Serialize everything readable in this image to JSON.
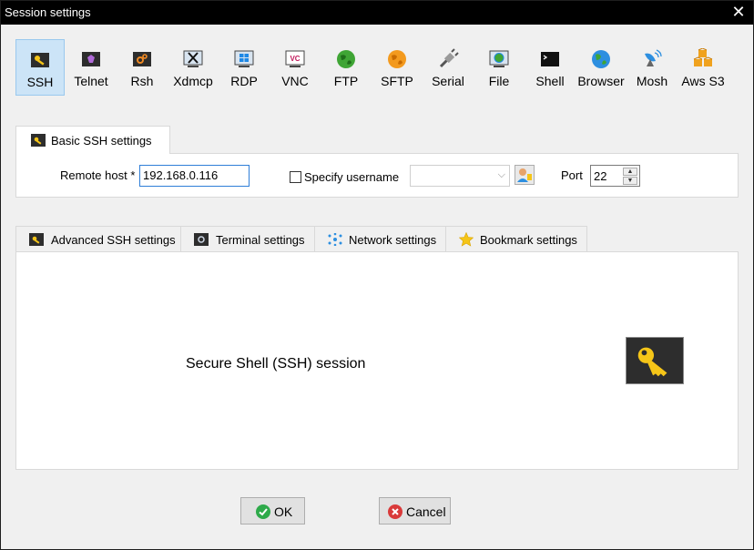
{
  "window": {
    "title": "Session settings"
  },
  "session_types": [
    {
      "label": "SSH",
      "icon": "ssh-key-icon"
    },
    {
      "label": "Telnet",
      "icon": "telnet-icon"
    },
    {
      "label": "Rsh",
      "icon": "rsh-icon"
    },
    {
      "label": "Xdmcp",
      "icon": "xdmcp-icon"
    },
    {
      "label": "RDP",
      "icon": "rdp-windows-icon"
    },
    {
      "label": "VNC",
      "icon": "vnc-icon"
    },
    {
      "label": "FTP",
      "icon": "ftp-globe-icon"
    },
    {
      "label": "SFTP",
      "icon": "sftp-icon"
    },
    {
      "label": "Serial",
      "icon": "serial-plug-icon"
    },
    {
      "label": "File",
      "icon": "file-monitor-icon"
    },
    {
      "label": "Shell",
      "icon": "shell-terminal-icon"
    },
    {
      "label": "Browser",
      "icon": "browser-globe-icon"
    },
    {
      "label": "Mosh",
      "icon": "mosh-satellite-icon"
    },
    {
      "label": "Aws S3",
      "icon": "aws-s3-cubes-icon"
    }
  ],
  "basic": {
    "tab_label": "Basic SSH settings",
    "remote_host_label": "Remote host *",
    "remote_host_value": "192.168.0.116",
    "specify_username_label": "Specify username",
    "username_value": "",
    "port_label": "Port",
    "port_value": "22"
  },
  "advanced_tabs": [
    {
      "label": "Advanced SSH settings",
      "icon": "key-icon"
    },
    {
      "label": "Terminal settings",
      "icon": "terminal-settings-icon"
    },
    {
      "label": "Network settings",
      "icon": "network-icon"
    },
    {
      "label": "Bookmark settings",
      "icon": "star-icon"
    }
  ],
  "panel": {
    "description": "Secure Shell (SSH) session"
  },
  "buttons": {
    "ok_label": "OK",
    "cancel_label": "Cancel"
  },
  "colors": {
    "accent": "#cce4f7",
    "key_yellow": "#f5c518",
    "ok_green": "#2eaa4a",
    "cancel_red": "#d93a3a"
  }
}
